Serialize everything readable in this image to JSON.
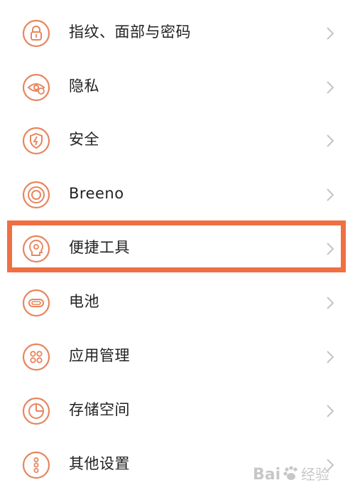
{
  "accent_color": "#e8855d",
  "highlight_color": "#ef6f42",
  "settings": {
    "items": [
      {
        "label": "指纹、面部与密码",
        "icon": "lock-icon"
      },
      {
        "label": "隐私",
        "icon": "privacy-eye-icon"
      },
      {
        "label": "安全",
        "icon": "shield-icon"
      },
      {
        "label": "Breeno",
        "icon": "breeno-icon"
      },
      {
        "label": "便捷工具",
        "icon": "convenience-tools-icon",
        "highlighted": true
      },
      {
        "label": "电池",
        "icon": "battery-icon"
      },
      {
        "label": "应用管理",
        "icon": "app-grid-icon"
      },
      {
        "label": "存储空间",
        "icon": "storage-pie-icon"
      },
      {
        "label": "其他设置",
        "icon": "more-dots-icon"
      }
    ]
  },
  "watermark": {
    "text": "Baidu经验"
  }
}
